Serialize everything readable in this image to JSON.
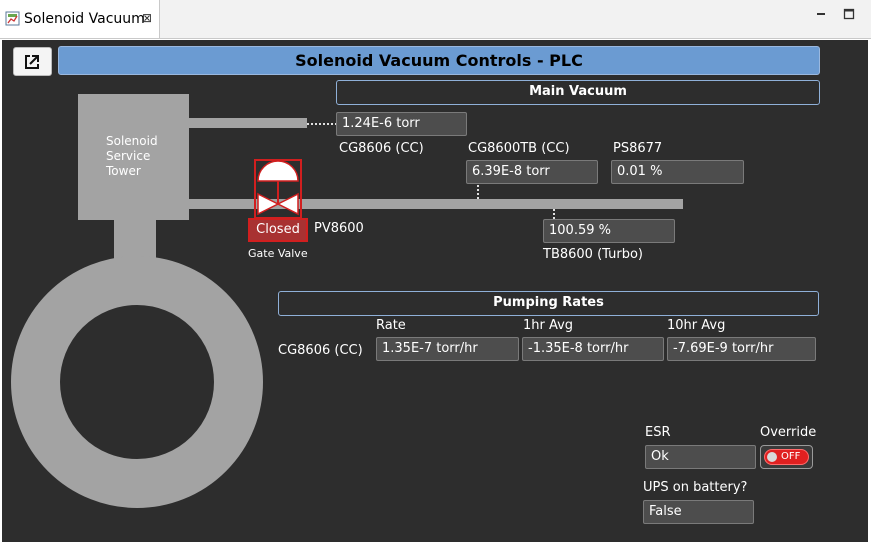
{
  "tab": {
    "title": "Solenoid Vacuum",
    "close_glyph": "⊠"
  },
  "header": {
    "title": "Solenoid Vacuum Controls - PLC",
    "popout_icon": "external-link-icon"
  },
  "tower": {
    "line1": "Solenoid",
    "line2": "Service",
    "line3": "Tower"
  },
  "main_vacuum": {
    "title": "Main Vacuum",
    "cg8606_value": "1.24E-6 torr",
    "cg8606_label": "CG8606 (CC)",
    "cg8600tb_label": "CG8600TB (CC)",
    "cg8600tb_value": "6.39E-8 torr",
    "ps8677_label": "PS8677",
    "ps8677_value": "0.01 %",
    "tb8600_value": "100.59 %",
    "tb8600_label": "TB8600 (Turbo)"
  },
  "gate_valve": {
    "state": "Closed",
    "id_label": "PV8600",
    "caption": "Gate Valve",
    "color": "#c81e1e"
  },
  "pumping_rates": {
    "title": "Pumping Rates",
    "row_label": "CG8606 (CC)",
    "col_rate": "Rate",
    "col_1hr": "1hr Avg",
    "col_10hr": "10hr Avg",
    "rate_value": "1.35E-7 torr/hr",
    "avg1_value": "-1.35E-8 torr/hr",
    "avg10_value": "-7.69E-9 torr/hr"
  },
  "esr": {
    "label": "ESR",
    "value": "Ok"
  },
  "override": {
    "label": "Override",
    "toggle_text": "OFF",
    "color": "#e02020"
  },
  "ups": {
    "label": "UPS on battery?",
    "value": "False"
  },
  "colors": {
    "header_blue": "#6b9bd2",
    "section_border": "#8fb0d8",
    "panel_bg": "#2d2d2d",
    "pipe_gray": "#a3a3a3"
  }
}
